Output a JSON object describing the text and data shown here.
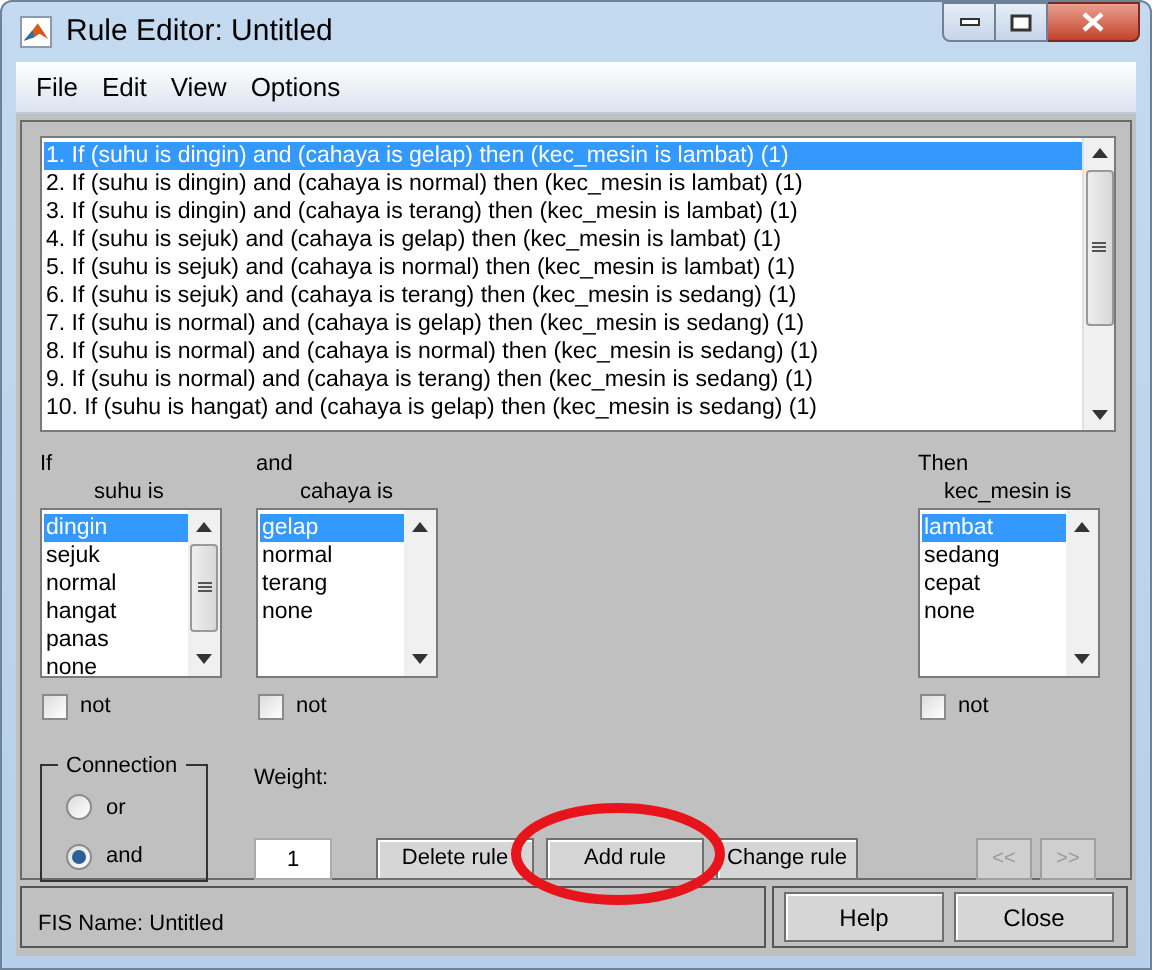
{
  "window": {
    "title": "Rule Editor: Untitled"
  },
  "menu": [
    "File",
    "Edit",
    "View",
    "Options"
  ],
  "rules": [
    {
      "text": "1. If (suhu is dingin) and (cahaya is gelap) then (kec_mesin is lambat) (1)",
      "selected": true
    },
    {
      "text": "2. If (suhu is dingin) and (cahaya is normal) then (kec_mesin is lambat) (1)",
      "selected": false
    },
    {
      "text": "3. If (suhu is dingin) and (cahaya is terang) then (kec_mesin is lambat) (1)",
      "selected": false
    },
    {
      "text": "4. If (suhu is sejuk) and (cahaya is gelap) then (kec_mesin is lambat) (1)",
      "selected": false
    },
    {
      "text": "5. If (suhu is sejuk) and (cahaya is normal) then (kec_mesin is lambat) (1)",
      "selected": false
    },
    {
      "text": "6. If (suhu is sejuk) and (cahaya is terang) then (kec_mesin is sedang) (1)",
      "selected": false
    },
    {
      "text": "7. If (suhu is normal) and (cahaya is gelap) then (kec_mesin is sedang) (1)",
      "selected": false
    },
    {
      "text": "8. If (suhu is normal) and (cahaya is normal) then (kec_mesin is sedang) (1)",
      "selected": false
    },
    {
      "text": "9. If (suhu is normal) and (cahaya is terang) then (kec_mesin is sedang) (1)",
      "selected": false
    },
    {
      "text": "10. If (suhu is hangat) and (cahaya is gelap) then (kec_mesin is sedang) (1)",
      "selected": false
    }
  ],
  "variables": [
    {
      "kind": "input",
      "connector": "If",
      "label": "suhu is",
      "not_label": "not",
      "not": false,
      "scroll_thumb": true,
      "options": [
        {
          "label": "dingin",
          "selected": true
        },
        {
          "label": "sejuk",
          "selected": false
        },
        {
          "label": "normal",
          "selected": false
        },
        {
          "label": "hangat",
          "selected": false
        },
        {
          "label": "panas",
          "selected": false
        },
        {
          "label": "none",
          "selected": false
        }
      ]
    },
    {
      "kind": "input",
      "connector": "and",
      "label": "cahaya is",
      "not_label": "not",
      "not": false,
      "scroll_thumb": false,
      "options": [
        {
          "label": "gelap",
          "selected": true
        },
        {
          "label": "normal",
          "selected": false
        },
        {
          "label": "terang",
          "selected": false
        },
        {
          "label": "none",
          "selected": false
        }
      ]
    },
    {
      "kind": "output",
      "connector": "Then",
      "label": "kec_mesin is",
      "not_label": "not",
      "not": false,
      "scroll_thumb": false,
      "options": [
        {
          "label": "lambat",
          "selected": true
        },
        {
          "label": "sedang",
          "selected": false
        },
        {
          "label": "cepat",
          "selected": false
        },
        {
          "label": "none",
          "selected": false
        }
      ]
    }
  ],
  "connection": {
    "title": "Connection",
    "options": [
      {
        "label": "or",
        "selected": false
      },
      {
        "label": "and",
        "selected": true
      }
    ]
  },
  "weight": {
    "label": "Weight:",
    "value": "1"
  },
  "buttons": [
    {
      "label": "Delete rule",
      "disabled": false
    },
    {
      "label": "Add rule",
      "disabled": false
    },
    {
      "label": "Change rule",
      "disabled": false
    }
  ],
  "nav_buttons": [
    {
      "label": "<<",
      "disabled": true
    },
    {
      "label": ">>",
      "disabled": true
    }
  ],
  "status": "FIS Name: Untitled",
  "footer_buttons": [
    "Help",
    "Close"
  ],
  "annotation": {
    "kind": "ellipse",
    "color": "#e8141c"
  }
}
